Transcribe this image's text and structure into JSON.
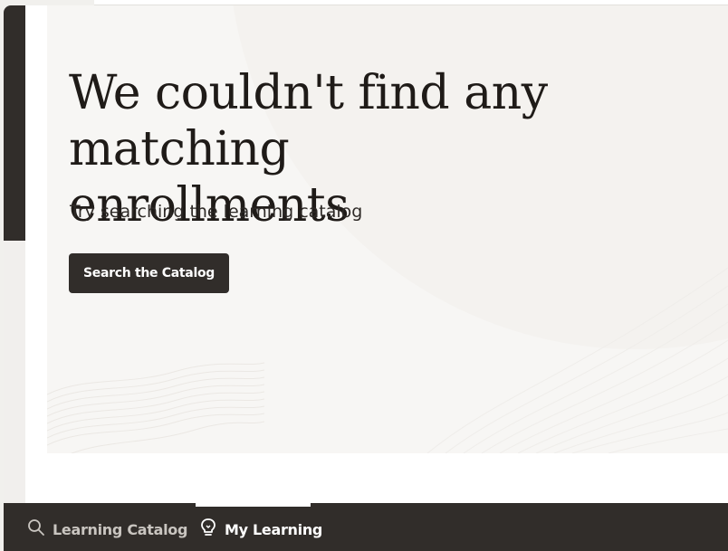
{
  "empty_state": {
    "heading": "We couldn't find any matching\nenrollments",
    "subtext": "Try searching the learning catalog",
    "button_label": "Search the Catalog"
  },
  "bottom_nav": {
    "items": [
      {
        "label": "Learning Catalog",
        "icon": "search-icon",
        "active": false
      },
      {
        "label": "My Learning",
        "icon": "lightbulb-icon",
        "active": true
      }
    ]
  },
  "colors": {
    "dark": "#312d2a",
    "panel": "#f7f6f4",
    "page_background": "#f1f0ed",
    "nav_inactive_text": "#c9c5c0",
    "nav_active_text": "#ffffff"
  }
}
